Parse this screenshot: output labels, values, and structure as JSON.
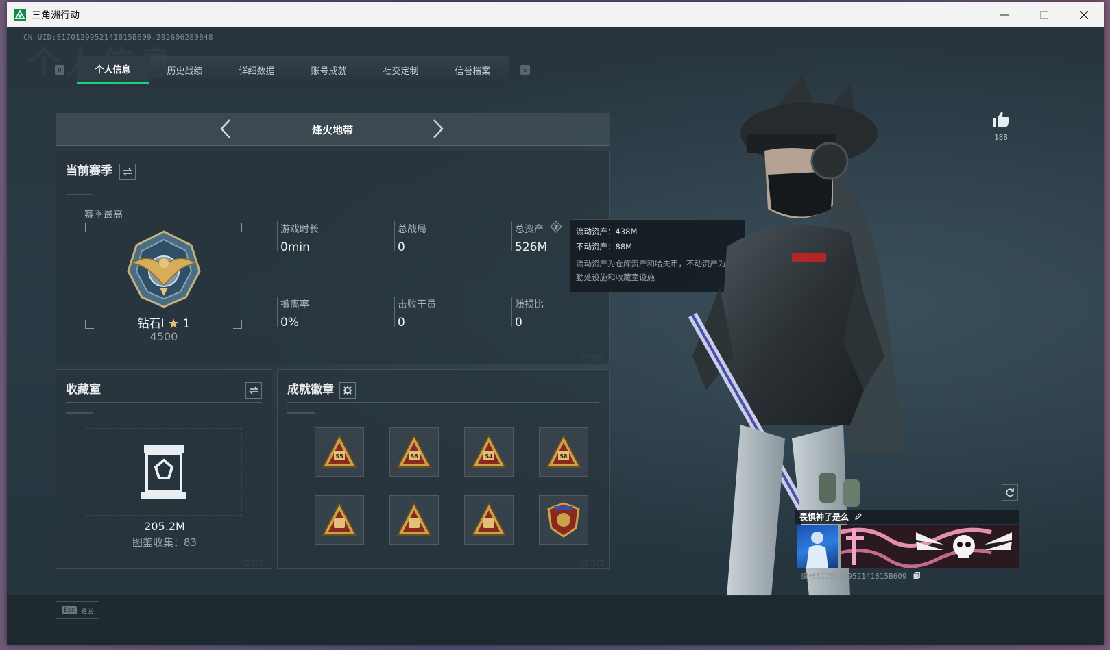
{
  "window": {
    "title": "三角洲行动"
  },
  "uid_text": "CN UID:8170129952141815B609.202606280848",
  "bg_heading": "个人信息",
  "tabs": [
    {
      "label": "个人信息",
      "active": true
    },
    {
      "label": "历史战绩"
    },
    {
      "label": "详细数据"
    },
    {
      "label": "账号成就"
    },
    {
      "label": "社交定制"
    },
    {
      "label": "信誉档案"
    }
  ],
  "tab_keys": {
    "left": "Q",
    "right": "E"
  },
  "mode": {
    "title": "烽火地带"
  },
  "season": {
    "title": "当前赛季",
    "best_label": "赛季最高",
    "rank_name": "钻石I",
    "rank_stars": "1",
    "rank_score": "4500",
    "stats": [
      {
        "label": "游戏时长",
        "value": "0min"
      },
      {
        "label": "总战局",
        "value": "0"
      },
      {
        "label": "总资产",
        "value": "526M"
      },
      {
        "label": "撤离率",
        "value": "0%"
      },
      {
        "label": "击败干员",
        "value": "0"
      },
      {
        "label": "赚损比",
        "value": "0"
      }
    ]
  },
  "tooltip": {
    "line1": "流动资产：438M",
    "line2": "不动资产：88M",
    "desc": "流动资产为仓库资产和哈夫币，不动资产为特勤处设施和收藏室设施"
  },
  "collection": {
    "title": "收藏室",
    "value": "205.2M",
    "catalog": "图鉴收集：83"
  },
  "achievements": {
    "title": "成就徽章",
    "badges": [
      {
        "name": "badge-s5",
        "label": "S5"
      },
      {
        "name": "badge-s6",
        "label": "S6"
      },
      {
        "name": "badge-s4",
        "label": "S4"
      },
      {
        "name": "badge-s8",
        "label": "S8"
      },
      {
        "name": "badge-trophy",
        "label": ""
      },
      {
        "name": "badge-jar",
        "label": ""
      },
      {
        "name": "badge-crate",
        "label": ""
      },
      {
        "name": "badge-shield",
        "label": ""
      }
    ]
  },
  "footer": {
    "esc_key": "Esc",
    "esc_label": "返回"
  },
  "profile": {
    "like_count": "188",
    "card_name": "畏惧神了是么",
    "card_id": "编号8170129952141815B609"
  },
  "colors": {
    "accent": "#1ed27a",
    "badge_gold": "#c9a24a",
    "badge_red": "#8a2a1e"
  }
}
